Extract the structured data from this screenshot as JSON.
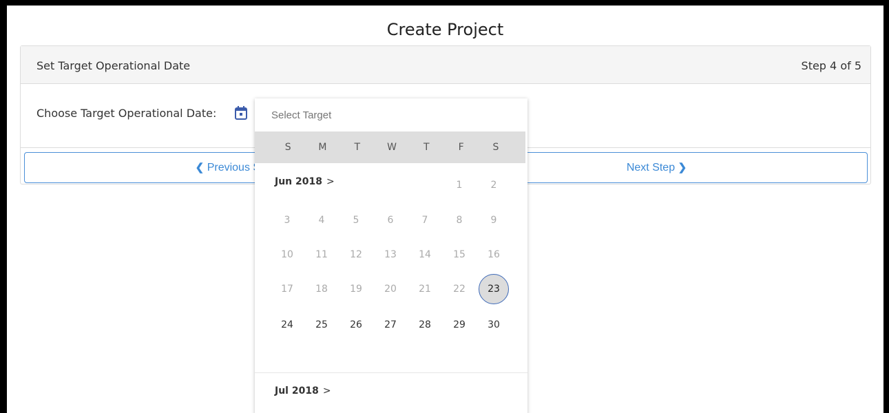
{
  "page": {
    "title": "Create Project"
  },
  "panel": {
    "header_title": "Set Target Operational Date",
    "step_text": "Step 4 of 5",
    "choose_label": "Choose Target Operational Date:",
    "calendar_icon": "calendar-icon",
    "prev_button": "Previous Step",
    "next_button": "Next Step"
  },
  "datepicker": {
    "placeholder": "Select Target",
    "weekdays": [
      "S",
      "M",
      "T",
      "W",
      "T",
      "F",
      "S"
    ],
    "current_month": "Jun 2018",
    "next_month": "Jul 2018",
    "selected_day": "23",
    "days": [
      "1",
      "2",
      "3",
      "4",
      "5",
      "6",
      "7",
      "8",
      "9",
      "10",
      "11",
      "12",
      "13",
      "14",
      "15",
      "16",
      "17",
      "18",
      "19",
      "20",
      "21",
      "22",
      "23",
      "24",
      "25",
      "26",
      "27",
      "28",
      "29",
      "30"
    ]
  },
  "colors": {
    "accent": "#3b89d6",
    "selected_ring": "#3e6ab8",
    "icon": "#3c5cab"
  }
}
